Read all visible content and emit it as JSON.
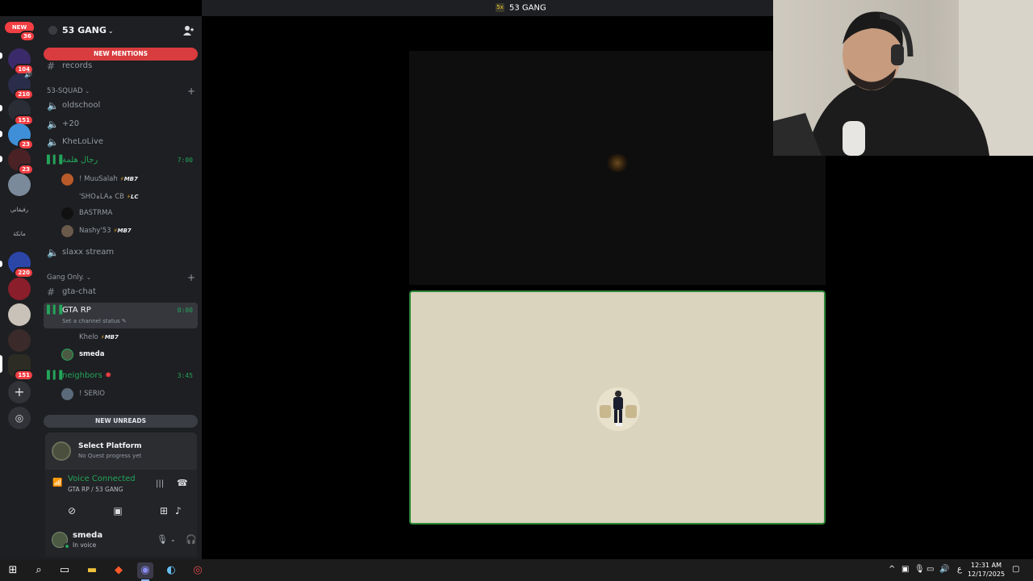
{
  "window": {
    "title": "53 GANG",
    "logo_text": "5x"
  },
  "rail": {
    "new_label": "NEW",
    "badges": [
      "36",
      "104",
      "210",
      "151",
      "23",
      "23",
      "220",
      "151"
    ],
    "text_items": [
      "رفيقاني",
      "مانكة"
    ]
  },
  "server": {
    "name": "53 GANG",
    "chevron": "⌄"
  },
  "banners": {
    "mentions": "NEW MENTIONS",
    "unreads": "NEW UNREADS"
  },
  "channels_top": [
    {
      "name": "records"
    }
  ],
  "categories": {
    "squad": "53-SQUAD",
    "gang": "Gang Only."
  },
  "squad_channels": [
    {
      "name": "oldschool"
    },
    {
      "name": "+20"
    },
    {
      "name": "KheLoLive"
    }
  ],
  "voice_active": {
    "name": "رجال هلمة",
    "time": "7:00",
    "users": [
      {
        "name": "! MuuSalah",
        "tag": "MB7"
      },
      {
        "name": "'SHOہLAہ CB",
        "tag": "LC"
      },
      {
        "name": "BASTRMA",
        "tag": ""
      },
      {
        "name": "Nashy'53",
        "tag": "MB7"
      }
    ]
  },
  "slaxx": {
    "name": "slaxx stream"
  },
  "gang_channels": {
    "chat": "gta-chat",
    "gta_rp": {
      "name": "GTA RP",
      "time": "0:00",
      "status": "Set a channel status",
      "users": [
        {
          "name": "Khelo",
          "tag": "MB7"
        },
        {
          "name": "smeda",
          "tag": ""
        }
      ]
    },
    "neighbors": {
      "name": "neighbors",
      "time": "3:45",
      "users": [
        {
          "name": "! SERIO"
        }
      ]
    }
  },
  "quest": {
    "title": "Select Platform",
    "subtitle": "No Quest progress yet"
  },
  "voice_panel": {
    "title": "Voice Connected",
    "subtitle": "GTA RP / 53 GANG"
  },
  "user_panel": {
    "name": "smeda",
    "status": "In voice"
  },
  "taskbar": {
    "time": "12:31 AM",
    "date": "12/17/2025",
    "lang": "ع"
  }
}
